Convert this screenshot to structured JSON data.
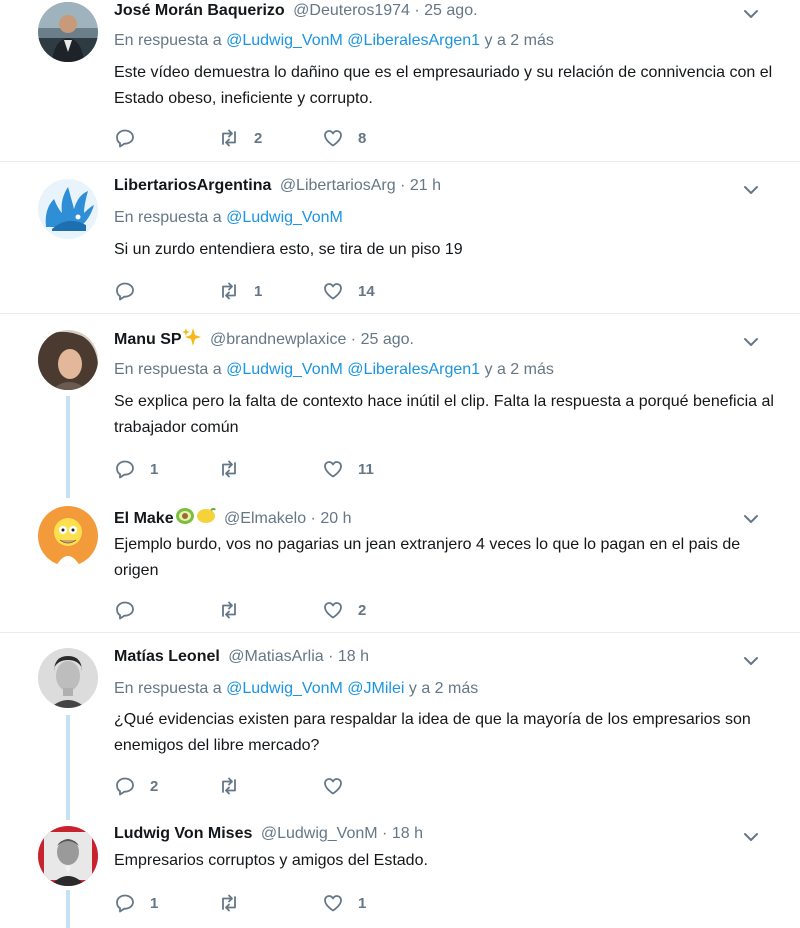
{
  "tweets": [
    {
      "name": "José Morán Baquerizo",
      "handle": "@Deuteros1974",
      "dot": "·",
      "time": "25 ago.",
      "reply_prefix": "En respuesta a",
      "mentions": [
        "@Ludwig_VonM",
        "@LiberalesArgen1"
      ],
      "reply_suffix": "y a 2 más",
      "text": "Este vídeo demuestra lo dañino que es el empresauriado y su relación de connivencia con el Estado obeso, ineficiente y corrupto.",
      "replies": "",
      "retweets": "2",
      "likes": "8"
    },
    {
      "name": "LibertariosArgentina",
      "handle": "@LibertariosArg",
      "dot": "·",
      "time": "21 h",
      "reply_prefix": "En respuesta a",
      "mentions": [
        "@Ludwig_VonM"
      ],
      "reply_suffix": "",
      "text": "Si un zurdo entendiera esto, se tira de un piso 19",
      "replies": "",
      "retweets": "1",
      "likes": "14"
    },
    {
      "name": "Manu SP",
      "name_emoji": "sparkles",
      "handle": "@brandnewplaxice",
      "dot": "·",
      "time": "25 ago.",
      "reply_prefix": "En respuesta a",
      "mentions": [
        "@Ludwig_VonM",
        "@LiberalesArgen1"
      ],
      "reply_suffix": "y a 2 más",
      "text": "Se explica pero la falta de contexto hace inútil el clip. Falta la respuesta a porqué beneficia al trabajador común",
      "replies": "1",
      "retweets": "",
      "likes": "11"
    },
    {
      "name": "El Make",
      "name_emoji": "avocado, lemon",
      "handle": "@Elmakelo",
      "dot": "·",
      "time": "20 h",
      "text": "Ejemplo burdo, vos no pagarias un jean extranjero 4 veces lo que lo pagan en el pais de origen",
      "replies": "",
      "retweets": "",
      "likes": "2"
    },
    {
      "name": "Matías Leonel",
      "handle": "@MatiasArlia",
      "dot": "·",
      "time": "18 h",
      "reply_prefix": "En respuesta a",
      "mentions": [
        "@Ludwig_VonM",
        "@JMilei"
      ],
      "reply_suffix": "y a 2 más",
      "text": "¿Qué evidencias existen para respaldar la idea de que la mayoría de los empresarios son enemigos del libre mercado?",
      "replies": "2",
      "retweets": "",
      "likes": ""
    },
    {
      "name": "Ludwig Von Mises",
      "handle": "@Ludwig_VonM",
      "dot": "·",
      "time": "18 h",
      "text": "Empresarios corruptos y amigos del Estado.",
      "replies": "1",
      "retweets": "",
      "likes": "1"
    }
  ],
  "colors": {
    "link": "#1b95e0",
    "muted": "#657786",
    "text": "#14171a",
    "thread_line": "#c4e1f6",
    "separator": "#e6ecf0"
  },
  "icons": {
    "reply": "reply-icon",
    "retweet": "retweet-icon",
    "like": "heart-icon",
    "menu": "chevron-down-icon"
  }
}
